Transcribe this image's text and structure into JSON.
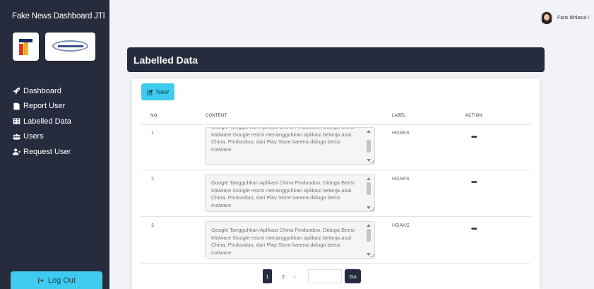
{
  "app": {
    "title": "Fake News Dashboard JTI"
  },
  "sidebar": {
    "items": [
      {
        "label": "Dashboard",
        "icon": "rocket-icon"
      },
      {
        "label": "Report User",
        "icon": "report-icon"
      },
      {
        "label": "Labelled Data",
        "icon": "table-icon"
      },
      {
        "label": "Users",
        "icon": "users-icon"
      },
      {
        "label": "Request User",
        "icon": "user-plus-icon"
      }
    ],
    "logout_label": "Log Out"
  },
  "user": {
    "name": "Faris Ikhlasul I"
  },
  "page": {
    "title": "Labelled Data"
  },
  "toolbar": {
    "new_label": "New"
  },
  "table": {
    "headers": {
      "no": "NO.",
      "content": "CONTENT",
      "label": "LABEL",
      "action": "ACTION"
    },
    "rows": [
      {
        "no": "1",
        "content": "Google Tangguhkan Aplikasi China Pinduoduo, Diduga Berisi Malware Google resmi menangguhkan aplikasi belanja asal China, Pinduoduo, dari Play Store karena diduga berisi malware",
        "label": "HOAKS",
        "action": "•••"
      },
      {
        "no": "2",
        "content": "Google Tangguhkan Aplikasi China Pinduoduo, Diduga Berisi Malware Google resmi menangguhkan aplikasi belanja asal China, Pinduoduo, dari Play Store karena diduga berisi malware",
        "label": "HOAKS",
        "action": "•••"
      },
      {
        "no": "3",
        "content": "Google Tangguhkan Aplikasi China Pinduoduo, Diduga Berisi Malware Google resmi menangguhkan aplikasi belanja asal China, Pinduoduo, dari Play Store karena diduga berisi malware",
        "label": "HOAKS",
        "action": "•••"
      }
    ]
  },
  "pagination": {
    "pages": [
      "1",
      "2"
    ],
    "next": "›",
    "current": "1",
    "go_label": "Go",
    "go_value": ""
  },
  "colors": {
    "sidebar_bg": "#272b3e",
    "accent": "#3ecbf0",
    "page_bg": "#f1f3f6"
  }
}
